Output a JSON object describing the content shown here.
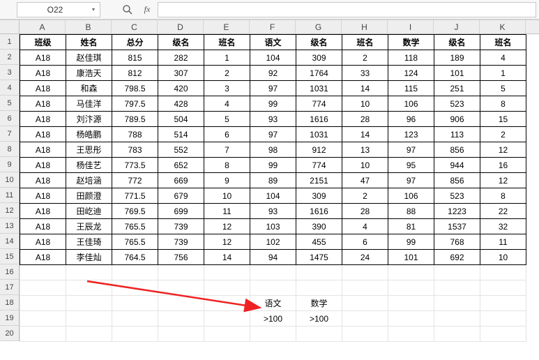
{
  "name_box": "O22",
  "formula_input": "",
  "columns": [
    "A",
    "B",
    "C",
    "D",
    "E",
    "F",
    "G",
    "H",
    "I",
    "J",
    "K"
  ],
  "row_count": 20,
  "headers": [
    "班级",
    "姓名",
    "总分",
    "级名",
    "班名",
    "语文",
    "级名",
    "班名",
    "数学",
    "级名",
    "班名"
  ],
  "rows": [
    [
      "A18",
      "赵佳琪",
      "815",
      "282",
      "1",
      "104",
      "309",
      "2",
      "118",
      "189",
      "4"
    ],
    [
      "A18",
      "康浩天",
      "812",
      "307",
      "2",
      "92",
      "1764",
      "33",
      "124",
      "101",
      "1"
    ],
    [
      "A18",
      "和森",
      "798.5",
      "420",
      "3",
      "97",
      "1031",
      "14",
      "115",
      "251",
      "5"
    ],
    [
      "A18",
      "马佳洋",
      "797.5",
      "428",
      "4",
      "99",
      "774",
      "10",
      "106",
      "523",
      "8"
    ],
    [
      "A18",
      "刘汴源",
      "789.5",
      "504",
      "5",
      "93",
      "1616",
      "28",
      "96",
      "906",
      "15"
    ],
    [
      "A18",
      "杨皓鹏",
      "788",
      "514",
      "6",
      "97",
      "1031",
      "14",
      "123",
      "113",
      "2"
    ],
    [
      "A18",
      "王思彤",
      "783",
      "552",
      "7",
      "98",
      "912",
      "13",
      "97",
      "856",
      "12"
    ],
    [
      "A18",
      "杨佳艺",
      "773.5",
      "652",
      "8",
      "99",
      "774",
      "10",
      "95",
      "944",
      "16"
    ],
    [
      "A18",
      "赵培涵",
      "772",
      "669",
      "9",
      "89",
      "2151",
      "47",
      "97",
      "856",
      "12"
    ],
    [
      "A18",
      "田颜澄",
      "771.5",
      "679",
      "10",
      "104",
      "309",
      "2",
      "106",
      "523",
      "8"
    ],
    [
      "A18",
      "田屹迪",
      "769.5",
      "699",
      "11",
      "93",
      "1616",
      "28",
      "88",
      "1223",
      "22"
    ],
    [
      "A18",
      "王辰龙",
      "765.5",
      "739",
      "12",
      "103",
      "390",
      "4",
      "81",
      "1537",
      "32"
    ],
    [
      "A18",
      "王佳琦",
      "765.5",
      "739",
      "12",
      "102",
      "455",
      "6",
      "99",
      "768",
      "11"
    ],
    [
      "A18",
      "李佳灿",
      "764.5",
      "756",
      "14",
      "94",
      "1475",
      "24",
      "101",
      "692",
      "10"
    ]
  ],
  "criteria": {
    "f18": "语文",
    "g18": "数学",
    "f19": ">100",
    "g19": ">100"
  },
  "chart_data": {
    "type": "table",
    "title": "",
    "columns": [
      "班级",
      "姓名",
      "总分",
      "级名",
      "班名",
      "语文",
      "级名",
      "班名",
      "数学",
      "级名",
      "班名"
    ],
    "data": [
      [
        "A18",
        "赵佳琪",
        815,
        282,
        1,
        104,
        309,
        2,
        118,
        189,
        4
      ],
      [
        "A18",
        "康浩天",
        812,
        307,
        2,
        92,
        1764,
        33,
        124,
        101,
        1
      ],
      [
        "A18",
        "和森",
        798.5,
        420,
        3,
        97,
        1031,
        14,
        115,
        251,
        5
      ],
      [
        "A18",
        "马佳洋",
        797.5,
        428,
        4,
        99,
        774,
        10,
        106,
        523,
        8
      ],
      [
        "A18",
        "刘汴源",
        789.5,
        504,
        5,
        93,
        1616,
        28,
        96,
        906,
        15
      ],
      [
        "A18",
        "杨皓鹏",
        788,
        514,
        6,
        97,
        1031,
        14,
        123,
        113,
        2
      ],
      [
        "A18",
        "王思彤",
        783,
        552,
        7,
        98,
        912,
        13,
        97,
        856,
        12
      ],
      [
        "A18",
        "杨佳艺",
        773.5,
        652,
        8,
        99,
        774,
        10,
        95,
        944,
        16
      ],
      [
        "A18",
        "赵培涵",
        772,
        669,
        9,
        89,
        2151,
        47,
        97,
        856,
        12
      ],
      [
        "A18",
        "田颜澄",
        771.5,
        679,
        10,
        104,
        309,
        2,
        106,
        523,
        8
      ],
      [
        "A18",
        "田屹迪",
        769.5,
        699,
        11,
        93,
        1616,
        28,
        88,
        1223,
        22
      ],
      [
        "A18",
        "王辰龙",
        765.5,
        739,
        12,
        103,
        390,
        4,
        81,
        1537,
        32
      ],
      [
        "A18",
        "王佳琦",
        765.5,
        739,
        12,
        102,
        455,
        6,
        99,
        768,
        11
      ],
      [
        "A18",
        "李佳灿",
        764.5,
        756,
        14,
        94,
        1475,
        24,
        101,
        692,
        10
      ]
    ]
  }
}
